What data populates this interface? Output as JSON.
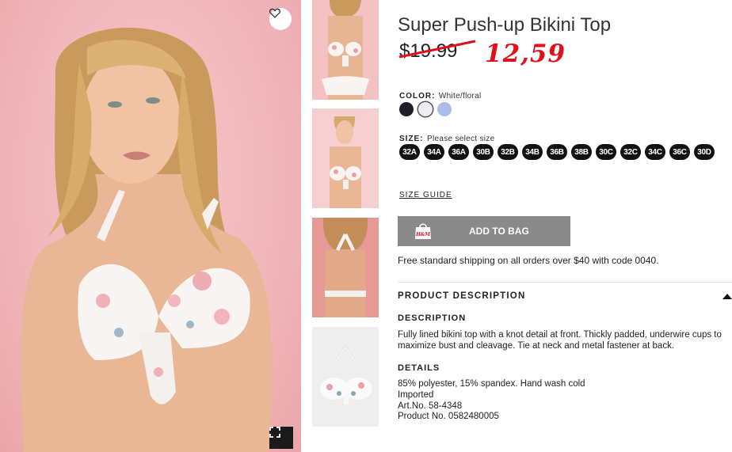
{
  "product": {
    "title": "Super Push-up Bikini Top",
    "old_price": "$19.99",
    "new_price": "12,59"
  },
  "color": {
    "label": "COLOR:",
    "value": "White/floral",
    "swatches": [
      {
        "name": "black",
        "hex": "#1e1e24"
      },
      {
        "name": "white-floral",
        "hex": "#eeeef2"
      },
      {
        "name": "light-blue",
        "hex": "#aabde6"
      }
    ]
  },
  "size": {
    "label": "SIZE:",
    "value": "Please select size",
    "options": [
      "32A",
      "34A",
      "36A",
      "30B",
      "32B",
      "34B",
      "36B",
      "38B",
      "30C",
      "32C",
      "34C",
      "36C",
      "30D"
    ]
  },
  "size_guide": "SIZE GUIDE",
  "add_to_bag": "ADD TO BAG",
  "bag_icon_text": "H&M",
  "shipping": "Free standard shipping on all orders over $40 with code 0040.",
  "product_description": {
    "heading": "PRODUCT DESCRIPTION",
    "description_heading": "DESCRIPTION",
    "description_lines": [
      "Fully lined bikini top with a knot detail at front. Thickly padded, underwire cups to",
      "maximize bust and cleavage. Tie at neck and metal fastener at back."
    ],
    "details_heading": "DETAILS",
    "details_lines": [
      "85% polyester, 15% spandex. Hand wash cold",
      "Imported",
      "Art.No. 58-4348",
      "Product No. 0582480005"
    ]
  },
  "icons": {
    "favorite": "heart-icon",
    "fullscreen": "expand-icon",
    "bag": "shopping-bag-icon",
    "collapse": "caret-up-icon"
  },
  "colors": {
    "accent_price": "#e0101b",
    "button_bg": "#8a8a8a",
    "photo_bg": "#f1b6b9"
  }
}
